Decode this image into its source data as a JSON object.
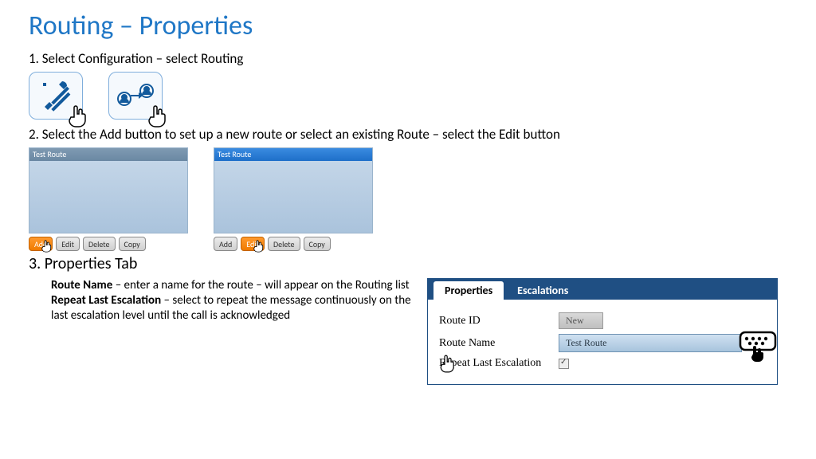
{
  "title": "Routing – Properties",
  "steps": {
    "s1": "1. Select Configuration – select Routing",
    "s2": "2. Select the Add button to set up a new route or select an existing Route – select the Edit button",
    "s3": "3. Properties Tab"
  },
  "panels": {
    "left_header": "Test Route",
    "right_header": "Test Route",
    "buttons": {
      "add": "Add",
      "edit": "Edit",
      "delete": "Delete",
      "copy": "Copy"
    }
  },
  "desc": {
    "route_name_label": "Route Name",
    "route_name_text": " – enter a name for the route – will appear on the Routing list",
    "repeat_label": "Repeat Last Escalation",
    "repeat_text": " – select to repeat the message continuously on the last escalation level until the call is acknowledged"
  },
  "properties": {
    "tabs": {
      "properties": "Properties",
      "escalations": "Escalations"
    },
    "route_id_label": "Route ID",
    "route_id_value": "New",
    "route_name_label": "Route Name",
    "route_name_value": "Test Route",
    "repeat_label": "Repeat Last Escalation"
  }
}
